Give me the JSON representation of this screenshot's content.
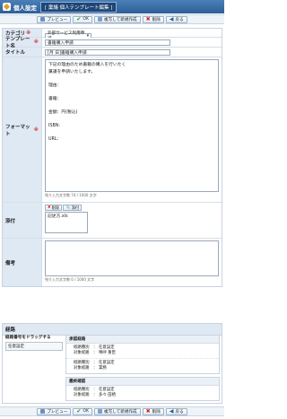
{
  "header": {
    "title": "個人設定",
    "subtitle": "[ 稟議 個人テンプレート編集 ]"
  },
  "toolbar": {
    "preview": "プレビュー",
    "ok": "OK",
    "save_new": "複写して新規作成",
    "delete": "削除",
    "back": "戻る"
  },
  "form": {
    "category": {
      "label": "カテゴリ",
      "value": "外部サービス利用申請"
    },
    "template_name": {
      "label": "テンプレート名",
      "value": "書籍購入申請"
    },
    "title": {
      "label": "タイトル",
      "value": "[月 日]書籍購入申請"
    },
    "format": {
      "label": "フォーマット",
      "lines": [
        "下記の理由のため書籍の購入を行いたく",
        "稟議を申請いたします。",
        "",
        "理由：",
        "",
        "書籍：",
        "",
        "金額：円(税込)",
        "",
        "ISBN:",
        "",
        "URL:"
      ],
      "hint": "残り入力文字数 74 / 1000 文字"
    },
    "attachment": {
      "label": "添付",
      "delete_btn": "削除",
      "attach_btn": "添付",
      "file": "記述方.xls"
    },
    "remarks": {
      "label": "備考",
      "hint": "残り入力文字数 0 / 1000 文字"
    }
  },
  "route": {
    "title": "経路",
    "drag_label": "経路番号をドラッグする",
    "route_name": "任意設定",
    "groups": [
      {
        "title": "承認経路",
        "entries": [
          [
            {
              "k": "経路種別",
              "v": "任意設定"
            },
            {
              "k": "対象経路",
              "v": "鳴呼 重臣"
            }
          ],
          [
            {
              "k": "経路種別",
              "v": "任意設定"
            },
            {
              "k": "対象経路",
              "v": "業務"
            }
          ]
        ]
      },
      {
        "title": "最終確認",
        "entries": [
          [
            {
              "k": "経路種別",
              "v": "任意設定"
            },
            {
              "k": "対象経路",
              "v": "多々 田栖"
            }
          ]
        ]
      }
    ]
  }
}
